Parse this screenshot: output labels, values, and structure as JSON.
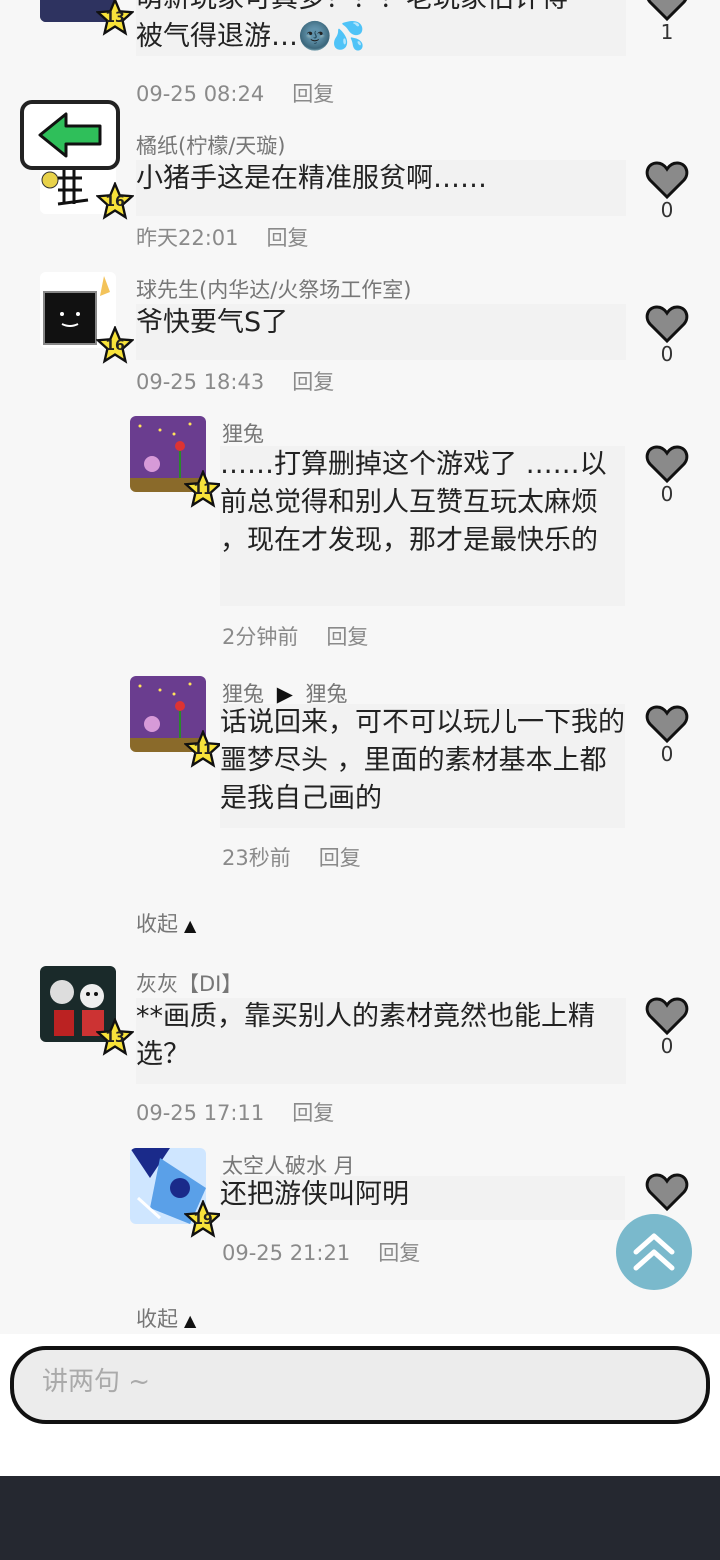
{
  "comments": [
    {
      "text": "被气得退游…🌚💦",
      "text_top_partial": "萌新玩家可真多！！！老玩家估计得",
      "time": "09-25 08:24",
      "reply": "回复",
      "likes": "1",
      "level": "13"
    },
    {
      "author": "橘纸(柠檬/天璇)",
      "text": "小猪手这是在精准服贫啊……",
      "time": "昨天22:01",
      "reply": "回复",
      "likes": "0",
      "level": "16"
    },
    {
      "author": "球先生(内华达/火祭场工作室)",
      "text": "爷快要气S了",
      "time": "09-25 18:43",
      "reply": "回复",
      "likes": "0",
      "level": "16",
      "replies": [
        {
          "author": "狸兔",
          "text": "……打算删掉这个游戏了 ……以前总觉得和别人互赞互玩太麻烦 ，现在才发现，那才是最快乐的",
          "time": "2分钟前",
          "reply": "回复",
          "likes": "0",
          "level": "11"
        },
        {
          "author": "狸兔",
          "arrow": "▶",
          "reply_to": "狸兔",
          "text": "话说回来，可不可以玩儿一下我的噩梦尽头 ，里面的素材基本上都是我自己画的",
          "time": "23秒前",
          "reply": "回复",
          "likes": "0",
          "level": "11"
        }
      ],
      "collapse": "收起"
    },
    {
      "author": "灰灰【DI】",
      "text": "**画质，靠买别人的素材竟然也能上精选？",
      "time": "09-25 17:11",
      "reply": "回复",
      "likes": "0",
      "level": "13",
      "replies": [
        {
          "author": "太空人破水 月",
          "text": "还把游侠叫阿明",
          "time": "09-25 21:21",
          "reply": "回复",
          "level": "19"
        }
      ],
      "collapse": "收起"
    }
  ],
  "input": {
    "placeholder": "讲两句 ~"
  },
  "colors": {
    "accent": "#7ab9cc",
    "badge": "#f7e23a",
    "back_arrow": "#2fbf5a",
    "bottom_bar": "#252830"
  },
  "icons": [
    "back-arrow-icon",
    "heart-icon",
    "star-badge-icon",
    "scroll-top-icon",
    "collapse-triangle-icon"
  ]
}
